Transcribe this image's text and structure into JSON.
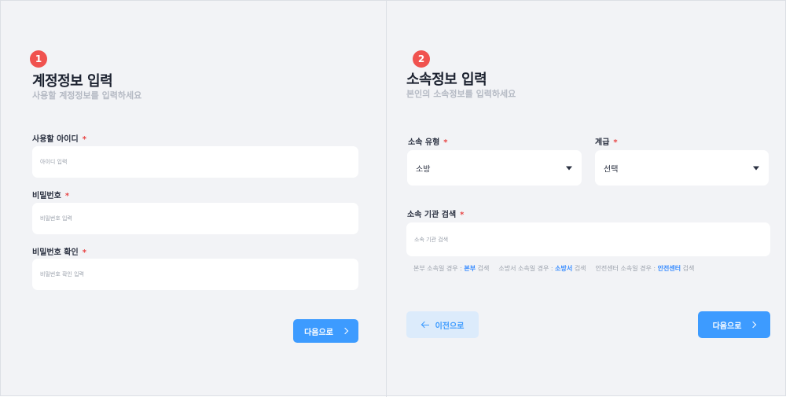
{
  "account": {
    "step": "1",
    "title": "계정정보 입력",
    "subtitle": "사용할 계정정보를 입력하세요",
    "fields": [
      {
        "label": "사용할 아이디",
        "required_mark": "*",
        "placeholder": "아이디 입력"
      },
      {
        "label": "비밀번호",
        "required_mark": "*",
        "placeholder": "비밀번호 입력"
      },
      {
        "label": "비밀번호 확인",
        "required_mark": "*",
        "placeholder": "비밀번호 확인 입력"
      }
    ],
    "next_label": "다음으로"
  },
  "affiliation": {
    "step": "2",
    "title": "소속정보 입력",
    "subtitle": "본인의 소속정보를 입력하세요",
    "type": {
      "label": "소속 유형",
      "required_mark": "*",
      "value": "소방"
    },
    "rank": {
      "label": "계급",
      "required_mark": "*",
      "value": "선택"
    },
    "org_search": {
      "label": "소속 기관 검색",
      "required_mark": "*",
      "placeholder": "소속 기관 검색"
    },
    "hints": [
      {
        "prefix": "본부 소속일 경우 :",
        "keyword": "본부",
        "suffix": "검색"
      },
      {
        "prefix": "소방서 소속일 경우 :",
        "keyword": "소방서",
        "suffix": "검색"
      },
      {
        "prefix": "안전센터 소속일 경우 :",
        "keyword": "안전센터",
        "suffix": "검색"
      }
    ],
    "prev_label": "이전으로",
    "next_label": "다음으로"
  },
  "colors": {
    "background": "#f2f3f6",
    "accent": "#3d9bff",
    "step_badge": "#f0524f",
    "required": "#e84545"
  },
  "icons": [
    "chevron-right-icon",
    "arrow-left-icon",
    "caret-down-icon"
  ]
}
